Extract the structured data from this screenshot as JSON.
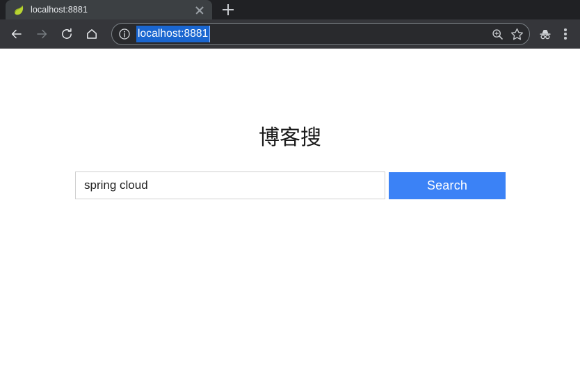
{
  "browser": {
    "tab": {
      "title": "localhost:8881",
      "favicon": "spring-leaf-favicon",
      "close_icon": "close-icon"
    },
    "new_tab_icon": "plus-icon",
    "nav": {
      "back_icon": "back-arrow-icon",
      "forward_icon": "forward-arrow-icon",
      "reload_icon": "reload-icon",
      "home_icon": "home-icon"
    },
    "omnibox": {
      "site_info_icon": "info-circle-icon",
      "url": "localhost:8881",
      "selected": true,
      "zoom_icon": "zoom-magnifier-icon",
      "bookmark_icon": "star-icon"
    },
    "incognito_icon": "incognito-icon",
    "menu_icon": "three-dot-menu-icon",
    "colors": {
      "tab_strip_bg": "#202124",
      "active_tab_bg": "#3c4043",
      "toolbar_bg": "#35363a",
      "url_selection": "#1a66d0"
    }
  },
  "page": {
    "title": "博客搜",
    "search": {
      "value": "spring cloud",
      "placeholder": "",
      "button_label": "Search",
      "button_color": "#3b82f6"
    }
  }
}
